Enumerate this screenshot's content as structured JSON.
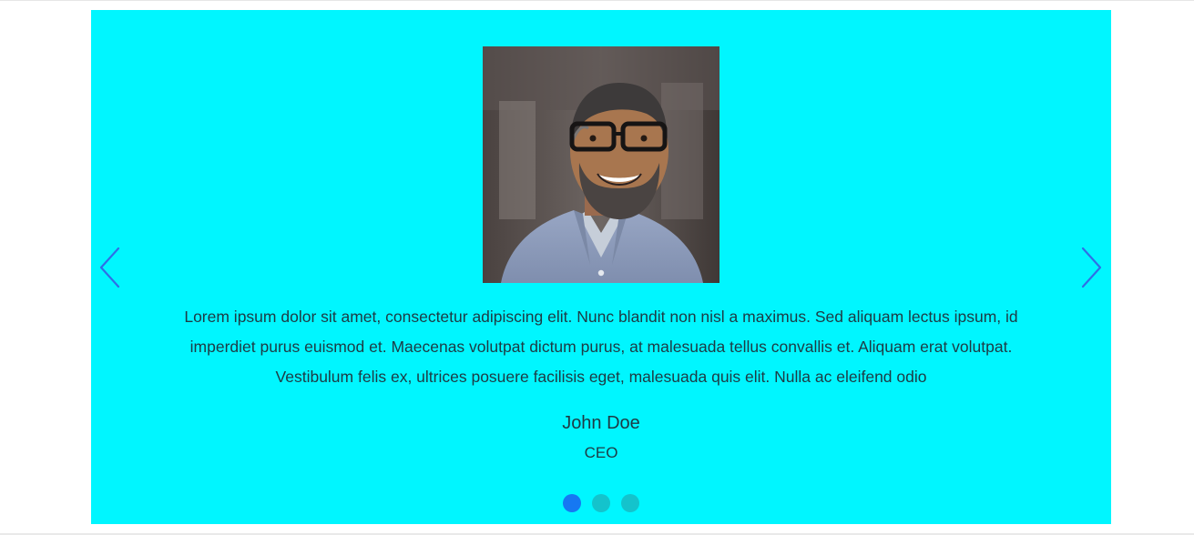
{
  "testimonial": {
    "quote": "Lorem ipsum dolor sit amet, consectetur adipiscing elit. Nunc blandit non nisl a maximus. Sed aliquam lectus ipsum, id imperdiet purus euismod et. Maecenas volutpat dictum purus, at malesuada tellus convallis et. Aliquam erat volutpat. Vestibulum felis ex, ultrices posuere facilisis eget, malesuada quis elit. Nulla ac eleifend odio",
    "name": "John Doe",
    "role": "CEO"
  },
  "navigation": {
    "prev_icon": "chevron-left-icon",
    "next_icon": "chevron-right-icon"
  },
  "pagination": {
    "total_slides": 3,
    "active_index": 0
  },
  "colors": {
    "slide_background": "#00f6ff",
    "text": "#1e3a44",
    "arrow": "#2f6fe6",
    "dot_active": "#1678f2",
    "dot_inactive": "#14c3cc",
    "page_background": "#ffffff"
  }
}
